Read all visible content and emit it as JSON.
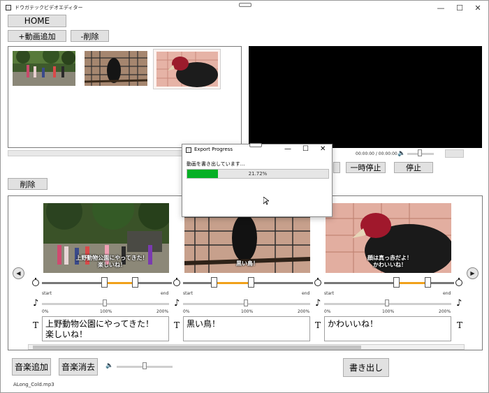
{
  "window": {
    "title": "ドウガテックビデオエディター",
    "minimize_glyph": "—",
    "maximize_glyph": "☐",
    "close_glyph": "✕"
  },
  "toolbar": {
    "home_label": "HOME",
    "add_video_label": "+動画追加",
    "delete_label": "-削除"
  },
  "player": {
    "time": "00:00:00 / 00:00:00",
    "pause_label": "一時停止",
    "stop_label": "停止",
    "volume_level": 0.3
  },
  "timeline": {
    "delete_label": "削除",
    "prev_glyph": "◀",
    "next_glyph": "▶",
    "clips": [
      {
        "caption": "上野動物公園にやってきた！\n楽しいね！",
        "start_label": "start",
        "end_label": "end",
        "speed_min": "0%",
        "speed_mid": "100%",
        "speed_max": "200%",
        "text": "上野動物公園にやってきた！\n楽しいね！"
      },
      {
        "caption": "黒い鳥！",
        "start_label": "start",
        "end_label": "end",
        "speed_min": "0%",
        "speed_mid": "100%",
        "speed_max": "200%",
        "text": "黒い鳥！"
      },
      {
        "caption": "顔は真っ赤だよ！\nかわいいね！",
        "start_label": "start",
        "end_label": "end",
        "speed_min": "0%",
        "speed_mid": "100%",
        "speed_max": "200%",
        "text": "かわいいね！"
      }
    ],
    "t_symbol": "T",
    "note_symbol": "♪"
  },
  "bottom": {
    "add_music_label": "音楽追加",
    "remove_music_label": "音楽消去",
    "export_label": "書き出し",
    "music_file": "ALong_Cold.mp3"
  },
  "export_dialog": {
    "title": "Export Progress",
    "message": "動画を書き出しています...",
    "percent_label": "21.72%",
    "progress": 0.2172,
    "colors": {
      "fill": "#06b025"
    }
  },
  "colors": {
    "trim_accent": "#f0a11a"
  }
}
